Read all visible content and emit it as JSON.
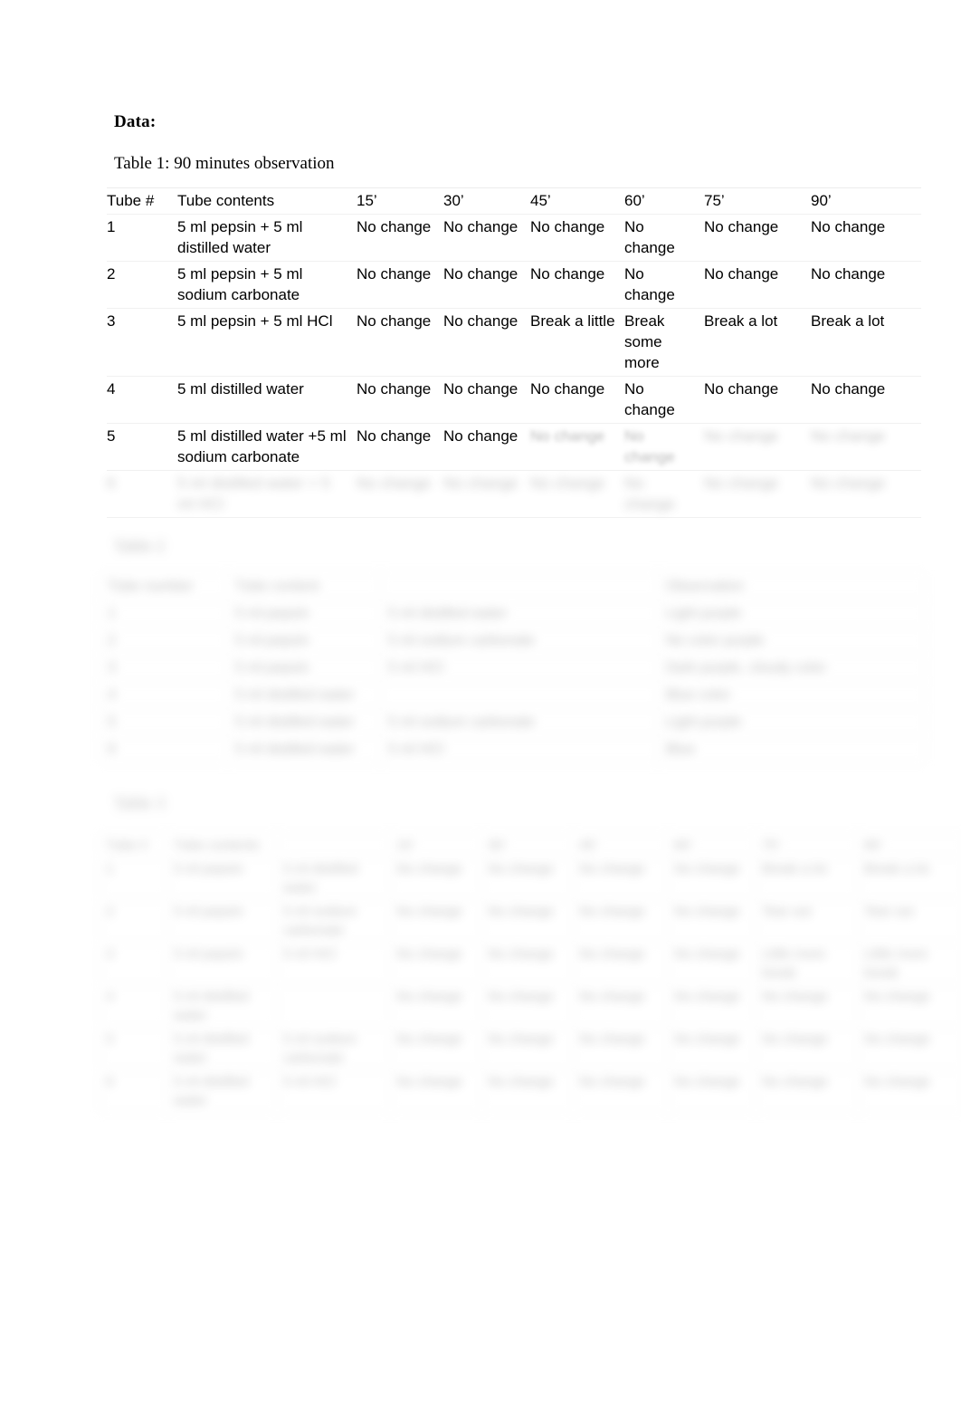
{
  "document": {
    "heading": "Data:",
    "table1_caption": "Table 1: 90 minutes observation",
    "table2_caption": "Table 2",
    "table3_caption": "Table 3"
  },
  "table1": {
    "headers": [
      "Tube #",
      "Tube contents",
      "15’",
      "30’",
      "45’",
      "60’",
      "75’",
      "90’"
    ],
    "rows": [
      {
        "tube": "1",
        "contents": "5 ml pepsin + 5 ml distilled water",
        "t15": "No change",
        "t30": "No change",
        "t45": "No change",
        "t60": "No change",
        "t75": "No change",
        "t90": "No change"
      },
      {
        "tube": "2",
        "contents": "5 ml pepsin + 5 ml sodium carbonate",
        "t15": "No change",
        "t30": "No change",
        "t45": "No change",
        "t60": "No change",
        "t75": "No change",
        "t90": "No change"
      },
      {
        "tube": "3",
        "contents": "5 ml pepsin + 5 ml HCl",
        "t15": "No change",
        "t30": "No change",
        "t45": "Break a little",
        "t60": "Break some more",
        "t75": "Break a lot",
        "t90": "Break a lot"
      },
      {
        "tube": "4",
        "contents": "5 ml distilled water",
        "t15": "No change",
        "t30": "No change",
        "t45": "No change",
        "t60": "No change",
        "t75": "No change",
        "t90": "No change"
      },
      {
        "tube": "5",
        "contents": "5 ml distilled water +5 ml sodium carbonate",
        "t15": "No change",
        "t30": "No change",
        "t45": "No change",
        "t60": "No change",
        "t75": "No change",
        "t90": "No change"
      },
      {
        "tube": "6",
        "contents": "5 ml distilled water + 5 ml HCl",
        "t15": "No change",
        "t30": "No change",
        "t45": "No change",
        "t60": "No change",
        "t75": "No change",
        "t90": "No change"
      }
    ]
  },
  "table2": {
    "headers": [
      "Tube number",
      "Tube content",
      "",
      "Observation"
    ],
    "rows": [
      {
        "num": "1",
        "a": "5 ml pepsin",
        "b": "5 ml distilled water",
        "obs": "Light purple"
      },
      {
        "num": "2",
        "a": "5 ml pepsin",
        "b": "5 ml sodium carbonate",
        "obs": "No color purple"
      },
      {
        "num": "3",
        "a": "5 ml pepsin",
        "b": "5 ml HCl",
        "obs": "Dark purple, cloudy color"
      },
      {
        "num": "4",
        "a": "5 ml distilled water",
        "b": "",
        "obs": "Blue color"
      },
      {
        "num": "5",
        "a": "5 ml distilled water",
        "b": "5 ml sodium carbonate",
        "obs": "Light purple"
      },
      {
        "num": "6",
        "a": "5 ml distilled water",
        "b": "5 ml HCl",
        "obs": "Blue"
      }
    ]
  },
  "table3": {
    "headers": [
      "Tube #",
      "Tube contents",
      "",
      "15’",
      "30’",
      "45’",
      "60’",
      "75’",
      "90’"
    ],
    "rows": [
      {
        "tube": "1",
        "a": "5 ml pepsin",
        "b": "5 ml distilled water",
        "t15": "No change",
        "t30": "No change",
        "t45": "No change",
        "t60": "No change",
        "t75": "Break a lot",
        "t90": "Break a lot"
      },
      {
        "tube": "2",
        "a": "5 ml pepsin",
        "b": "5 ml sodium carbonate",
        "t15": "No change",
        "t30": "No change",
        "t45": "No change",
        "t60": "No change",
        "t75": "Tear out",
        "t90": "Tear out"
      },
      {
        "tube": "3",
        "a": "5 ml pepsin",
        "b": "5 ml HCl",
        "t15": "No change",
        "t30": "No change",
        "t45": "No change",
        "t60": "No change",
        "t75": "Little more break",
        "t90": "Little more break"
      },
      {
        "tube": "4",
        "a": "5 ml distilled water",
        "b": "",
        "t15": "No change",
        "t30": "No change",
        "t45": "No change",
        "t60": "No change",
        "t75": "No change",
        "t90": "No change"
      },
      {
        "tube": "5",
        "a": "5 ml distilled water",
        "b": "5 ml sodium carbonate",
        "t15": "No change",
        "t30": "No change",
        "t45": "No change",
        "t60": "No change",
        "t75": "No change",
        "t90": "No change"
      },
      {
        "tube": "6",
        "a": "5 ml distilled water",
        "b": "5 ml HCl",
        "t15": "No change",
        "t30": "No change",
        "t45": "No change",
        "t60": "No change",
        "t75": "No change",
        "t90": "No change"
      }
    ]
  }
}
